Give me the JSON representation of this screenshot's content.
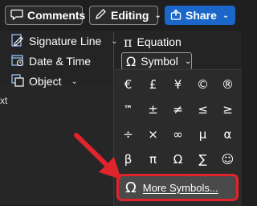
{
  "topbar": {
    "comments_label": "Comments",
    "editing_label": "Editing",
    "share_label": "Share"
  },
  "insert_group": {
    "signature_line_label": "Signature Line",
    "date_time_label": "Date & Time",
    "object_label": "Object",
    "side_text_fragment": "xt"
  },
  "symbols_group": {
    "equation_label": "Equation",
    "symbol_label": "Symbol"
  },
  "symbol_flyout": {
    "symbols": [
      "€",
      "£",
      "¥",
      "©",
      "®",
      "™",
      "±",
      "≠",
      "≤",
      "≥",
      "÷",
      "×",
      "∞",
      "µ",
      "α",
      "β",
      "π",
      "Ω",
      "∑",
      "☺"
    ],
    "more_symbols_label": "More Symbols...",
    "more_symbols_icon": "omega-icon"
  },
  "annotation": {
    "arrow_color": "#e0242b",
    "highlight_color": "#e0242b"
  }
}
